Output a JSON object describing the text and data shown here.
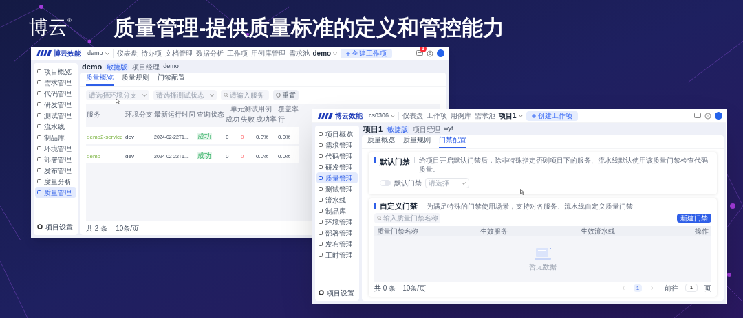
{
  "slide": {
    "brand": "博云",
    "brand_mark": "®",
    "title": "质量管理-提供质量标准的定义和管控能力"
  },
  "back_window": {
    "logo": "博云效能",
    "workspace": "demo",
    "nav": [
      {
        "label": "仪表盘",
        "selected": false
      },
      {
        "label": "待办项",
        "selected": false
      },
      {
        "label": "文档管理",
        "selected": false
      },
      {
        "label": "数据分析",
        "selected": false
      },
      {
        "label": "工作项",
        "selected": false
      },
      {
        "label": "用例库管理",
        "selected": false
      },
      {
        "label": "需求池",
        "selected": false
      }
    ],
    "project": "demo",
    "create_button": "创建工作项",
    "notification_badge": "1",
    "header": {
      "title": "demo",
      "tag": "敏捷版",
      "role": "项目经理",
      "user": "demo"
    },
    "sidebar": {
      "items": [
        {
          "label": "项目概览",
          "selected": false
        },
        {
          "label": "需求管理",
          "selected": false
        },
        {
          "label": "代码管理",
          "selected": false
        },
        {
          "label": "研发管理",
          "selected": false
        },
        {
          "label": "测试管理",
          "selected": false
        },
        {
          "label": "流水线",
          "selected": false
        },
        {
          "label": "制品库",
          "selected": false
        },
        {
          "label": "环境管理",
          "selected": false
        },
        {
          "label": "部署管理",
          "selected": false
        },
        {
          "label": "发布管理",
          "selected": false
        },
        {
          "label": "度量分析",
          "selected": false
        },
        {
          "label": "质量管理",
          "selected": true
        }
      ],
      "footer": "项目设置"
    },
    "tabs": [
      {
        "label": "质量概览",
        "selected": true
      },
      {
        "label": "质量规则",
        "selected": false
      },
      {
        "label": "门禁配置",
        "selected": false
      }
    ],
    "filters": {
      "branch_placeholder": "请选择环境分支",
      "status_placeholder": "请选择测试状态",
      "search_placeholder": "请输入服务",
      "reset_button": "重置"
    },
    "table": {
      "columns": [
        {
          "label": "服务"
        },
        {
          "label": "环境分支"
        },
        {
          "label": "最新运行时间"
        },
        {
          "label": "查询状态"
        },
        {
          "label": "单元测试用例",
          "children": [
            "成功",
            "失败",
            "成功率"
          ]
        },
        {
          "label": "覆盖率",
          "children": [
            "行"
          ]
        }
      ],
      "rows": [
        {
          "service": "demo2-service",
          "branch": "dev",
          "time": "2024-02-22T1...",
          "status": "成功",
          "success": "0",
          "failed": "0",
          "success_rate": "0.0%",
          "line_coverage": "0.0%"
        },
        {
          "service": "demo",
          "branch": "dev",
          "time": "2024-02-22T1...",
          "status": "成功",
          "success": "0",
          "failed": "0",
          "success_rate": "0.0%",
          "line_coverage": "0.0%"
        }
      ]
    },
    "footer": {
      "total": "共 2 条",
      "page_size": "10条/页"
    }
  },
  "front_window": {
    "logo": "博云效能",
    "workspace": "cs0306",
    "nav": [
      {
        "label": "仪表盘",
        "selected": false
      },
      {
        "label": "工作项",
        "selected": false
      },
      {
        "label": "用例库",
        "selected": false
      },
      {
        "label": "需求池",
        "selected": false
      }
    ],
    "project": "项目1",
    "create_button": "创建工作项",
    "header": {
      "title": "项目1",
      "tag": "敏捷版",
      "role": "项目经理",
      "user": "wyf"
    },
    "sidebar": {
      "items": [
        {
          "label": "项目概览",
          "selected": false
        },
        {
          "label": "需求管理",
          "selected": false
        },
        {
          "label": "代码管理",
          "selected": false
        },
        {
          "label": "研发管理",
          "selected": false
        },
        {
          "label": "质量管理",
          "selected": true
        },
        {
          "label": "测试管理",
          "selected": false
        },
        {
          "label": "流水线",
          "selected": false
        },
        {
          "label": "制品库",
          "selected": false
        },
        {
          "label": "环境管理",
          "selected": false
        },
        {
          "label": "部署管理",
          "selected": false
        },
        {
          "label": "发布管理",
          "selected": false
        },
        {
          "label": "工时管理",
          "selected": false
        }
      ],
      "footer": "项目设置"
    },
    "tabs": [
      {
        "label": "质量概览",
        "selected": false
      },
      {
        "label": "质量规则",
        "selected": false
      },
      {
        "label": "门禁配置",
        "selected": true
      }
    ],
    "default_gate": {
      "title": "默认门禁",
      "description": "给项目开启默认门禁后，除非特殊指定否则项目下的服务、流水线默认使用该质量门禁检查代码质量。",
      "toggle_on": false,
      "toggle_label": "默认门禁",
      "select_placeholder": "请选择"
    },
    "custom_gate": {
      "title": "自定义门禁",
      "description": "为满足特殊的门禁使用场景，支持对各服务、流水线自定义质量门禁",
      "search_placeholder": "输入质量门禁名称",
      "new_button": "新建门禁",
      "columns": [
        "质量门禁名称",
        "生效服务",
        "生效流水线",
        "操作"
      ],
      "empty_text": "暂无数据",
      "total": "共 0 条",
      "page_size": "10条/页",
      "pages": [
        {
          "label": "1",
          "selected": true
        }
      ],
      "goto_label": "前往",
      "goto_value": "1",
      "goto_suffix": "页"
    }
  }
}
